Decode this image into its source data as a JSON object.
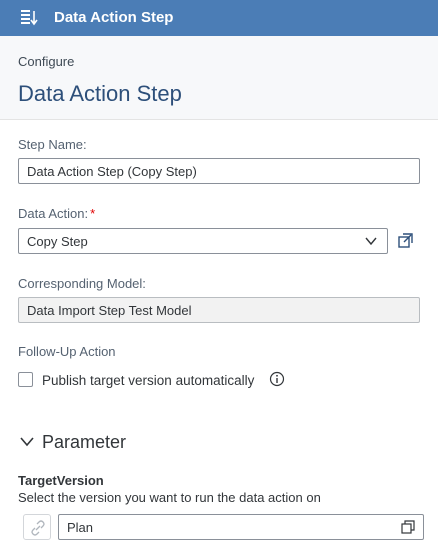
{
  "titlebar": {
    "title": "Data Action Step",
    "icon": "steps-icon"
  },
  "header": {
    "breadcrumb": "Configure",
    "title": "Data Action Step"
  },
  "step_name": {
    "label": "Step Name:",
    "value": "Data Action Step (Copy Step)"
  },
  "data_action": {
    "label": "Data Action:",
    "required_mark": "*",
    "value": "Copy Step"
  },
  "model": {
    "label": "Corresponding Model:",
    "value": "Data Import Step Test Model"
  },
  "follow_up": {
    "label": "Follow-Up Action",
    "checkbox_label": "Publish target version automatically",
    "checked": false
  },
  "parameter": {
    "section_title": "Parameter",
    "name": "TargetVersion",
    "description": "Select the version you want to run the data action on",
    "value": "Plan"
  },
  "colors": {
    "accent": "#4b7db6",
    "title_text": "#2d4f7a",
    "required": "#e00000"
  }
}
